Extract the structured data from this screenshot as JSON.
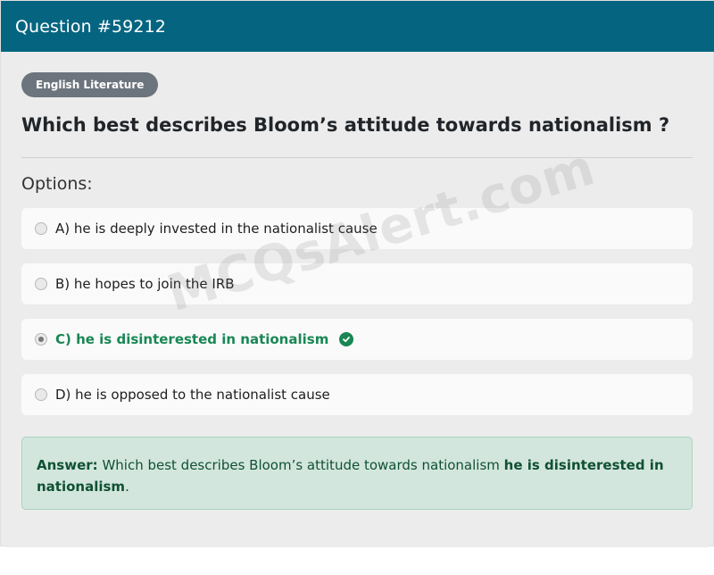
{
  "header": {
    "title": "Question #59212"
  },
  "category_badge": "English Literature",
  "question": "Which best describes Bloom’s attitude towards nationalism ?",
  "options_label": "Options:",
  "options": [
    {
      "text": "A) he is deeply invested in the nationalist cause",
      "selected": false,
      "correct": false
    },
    {
      "text": "B) he hopes to join the IRB",
      "selected": false,
      "correct": false
    },
    {
      "text": "C) he is disinterested in nationalism",
      "selected": true,
      "correct": true
    },
    {
      "text": "D) he is opposed to the nationalist cause",
      "selected": false,
      "correct": false
    }
  ],
  "answer": {
    "label": "Answer:",
    "text": "Which best describes Bloom’s attitude towards nationalism",
    "value": "he is disinterested in nationalism",
    "suffix": "."
  },
  "watermark": "MCQsAlert.com",
  "colors": {
    "header_bg": "#056580",
    "correct": "#198754",
    "answer_bg": "#d3e6de"
  }
}
